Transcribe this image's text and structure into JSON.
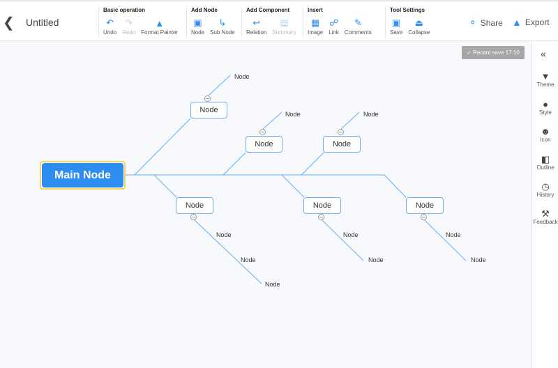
{
  "header": {
    "title": "Untitled",
    "share": "Share",
    "export": "Export"
  },
  "toolbar": {
    "groups": [
      {
        "label": "Basic operation",
        "tools": [
          {
            "label": "Undo",
            "icon": "undo-icon"
          },
          {
            "label": "Redo",
            "icon": "redo-icon",
            "disabled": true
          },
          {
            "label": "Format Painter",
            "icon": "brush-icon"
          }
        ]
      },
      {
        "label": "Add Node",
        "tools": [
          {
            "label": "Node",
            "icon": "node-icon"
          },
          {
            "label": "Sub Node",
            "icon": "sub-node-icon"
          }
        ]
      },
      {
        "label": "Add Component",
        "tools": [
          {
            "label": "Relation",
            "icon": "relation-icon"
          },
          {
            "label": "Summary",
            "icon": "summary-icon",
            "disabled": true
          }
        ]
      },
      {
        "label": "Insert",
        "tools": [
          {
            "label": "Image",
            "icon": "image-icon"
          },
          {
            "label": "Link",
            "icon": "link-icon"
          },
          {
            "label": "Comments",
            "icon": "pen-icon"
          }
        ]
      },
      {
        "label": "Tool Settings",
        "tools": [
          {
            "label": "Save",
            "icon": "save-icon"
          },
          {
            "label": "Collapse",
            "icon": "eject-icon"
          }
        ]
      }
    ]
  },
  "save_status": "Recent save 17:10",
  "panel": {
    "items": [
      {
        "label": "Theme",
        "icon": "shirt-icon"
      },
      {
        "label": "Style",
        "icon": "palette-icon"
      },
      {
        "label": "Icon",
        "icon": "smile-icon"
      },
      {
        "label": "Outline",
        "icon": "outline-icon"
      },
      {
        "label": "History",
        "icon": "clock-icon"
      },
      {
        "label": "Feedback",
        "icon": "wrench-icon"
      }
    ]
  },
  "map": {
    "main": "Main Node",
    "branches": [
      {
        "label": "Node",
        "children": [
          "Node"
        ]
      },
      {
        "label": "Node",
        "children": [
          "Node"
        ]
      },
      {
        "label": "Node",
        "children": [
          "Node"
        ]
      },
      {
        "label": "Node",
        "children": [
          "Node",
          "Node",
          "Node"
        ]
      },
      {
        "label": "Node",
        "children": [
          "Node",
          "Node"
        ]
      },
      {
        "label": "Node",
        "children": [
          "Node",
          "Node"
        ]
      }
    ]
  },
  "colors": {
    "accent": "#2d8cf0",
    "line": "#6aaef5",
    "main_border": "#f5d658"
  }
}
